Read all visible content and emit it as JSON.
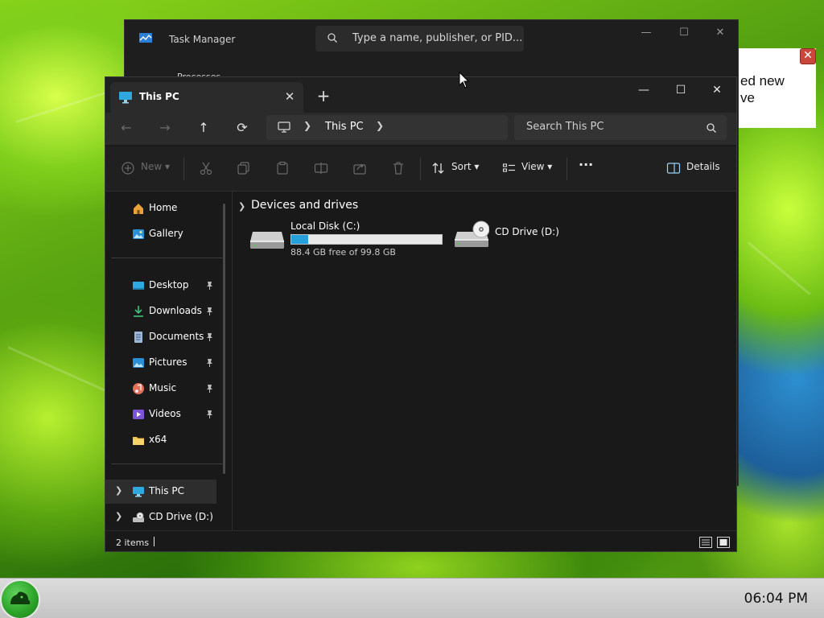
{
  "desktop": {
    "notification_text": "ed new\nve"
  },
  "task_manager": {
    "title": "Task Manager",
    "search_placeholder": "Type a name, publisher, or PID...",
    "strip_text": "Processes"
  },
  "explorer": {
    "tab_label": "This PC",
    "address_location": "This PC",
    "search_placeholder": "Search This PC",
    "toolbar": {
      "new_label": "New",
      "sort_label": "Sort",
      "view_label": "View",
      "more_label": "···",
      "details_label": "Details"
    },
    "sidebar": {
      "top_items": [
        {
          "label": "Home",
          "icon": "home-icon"
        },
        {
          "label": "Gallery",
          "icon": "gallery-icon"
        }
      ],
      "quick_access": [
        {
          "label": "Desktop",
          "icon": "desktop-folder-icon",
          "pinned": true
        },
        {
          "label": "Downloads",
          "icon": "downloads-icon",
          "pinned": true
        },
        {
          "label": "Documents",
          "icon": "documents-icon",
          "pinned": true
        },
        {
          "label": "Pictures",
          "icon": "pictures-icon",
          "pinned": true
        },
        {
          "label": "Music",
          "icon": "music-icon",
          "pinned": true
        },
        {
          "label": "Videos",
          "icon": "videos-icon",
          "pinned": true
        },
        {
          "label": "x64",
          "icon": "folder-icon",
          "pinned": false
        }
      ],
      "tree": [
        {
          "label": "This PC",
          "icon": "this-pc-icon",
          "selected": true
        },
        {
          "label": "CD Drive (D:)",
          "icon": "cd-drive-icon",
          "selected": false
        }
      ]
    },
    "content": {
      "group_label": "Devices and drives",
      "drives": [
        {
          "name": "Local Disk (C:)",
          "free_text": "88.4 GB free of 99.8 GB",
          "used_fraction": 0.114
        },
        {
          "name": "CD Drive (D:)"
        }
      ]
    },
    "status": {
      "item_count": "2 items"
    }
  },
  "taskbar": {
    "clock": "06:04 PM"
  },
  "colors": {
    "accent": "#26a0da",
    "explorer_bg": "#191919",
    "titlebar_bg": "#202020",
    "taskbar_bg": "#d0d0d0"
  }
}
